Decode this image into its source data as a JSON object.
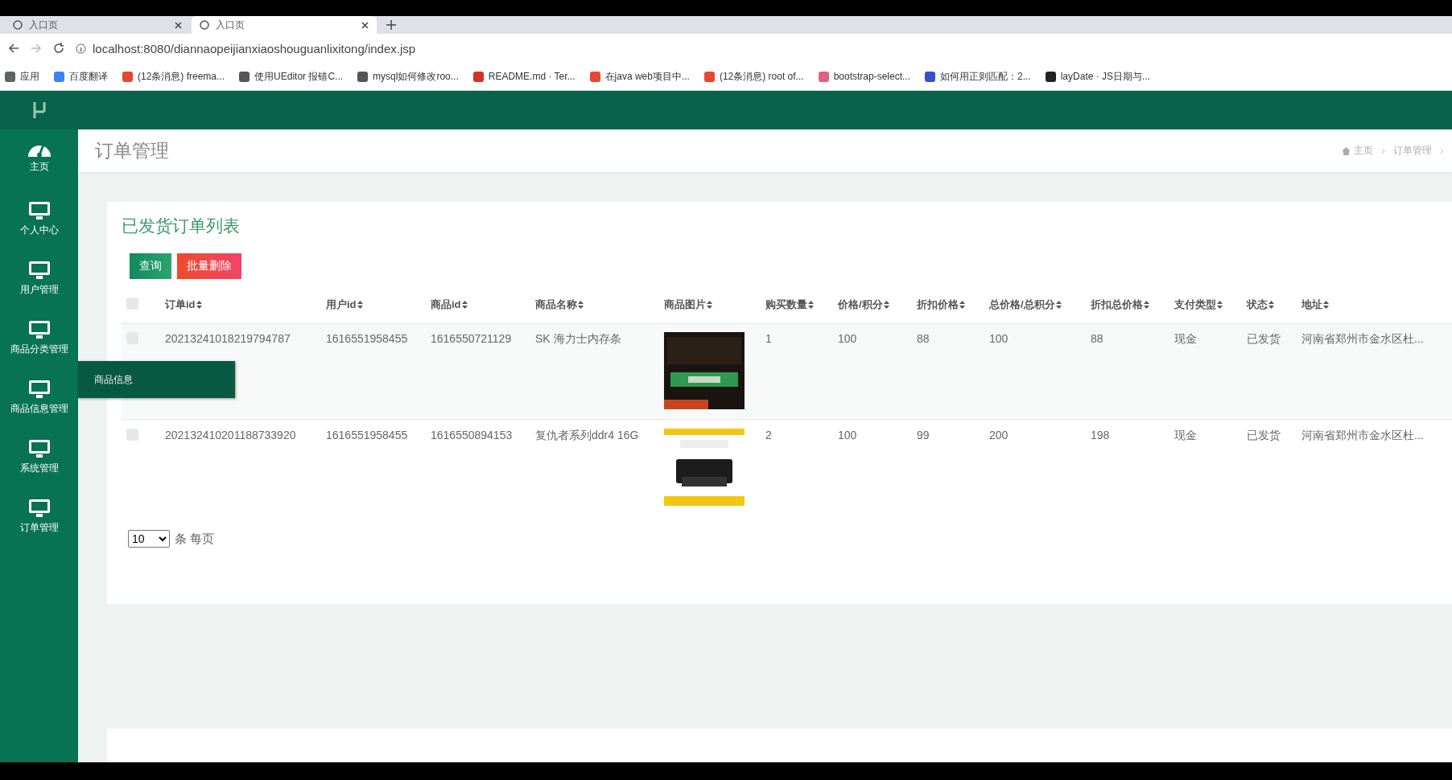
{
  "browser": {
    "tabs": [
      {
        "title": "入口页",
        "selected": false
      },
      {
        "title": "入口页",
        "selected": true
      }
    ],
    "url": "localhost:8080/diannaopeijianxiaoshouguanlixitong/index.jsp",
    "bookmarks": [
      {
        "label": "应用",
        "color": "#5f6368"
      },
      {
        "label": "百度翻译",
        "color": "#3b82f6"
      },
      {
        "label": "(12条消息) freema...",
        "color": "#e8472f"
      },
      {
        "label": "使用UEditor 报错C...",
        "color": "#555555"
      },
      {
        "label": "mysql如何修改roo...",
        "color": "#555555"
      },
      {
        "label": "README.md · Ter...",
        "color": "#d93025"
      },
      {
        "label": "在java web项目中...",
        "color": "#e8472f"
      },
      {
        "label": "(12条消息) root of...",
        "color": "#e8472f"
      },
      {
        "label": "bootstrap-select...",
        "color": "#e0607e"
      },
      {
        "label": "如何用正则匹配：2...",
        "color": "#3550c8"
      },
      {
        "label": "layDate · JS日期与...",
        "color": "#222222"
      }
    ]
  },
  "sidebar": {
    "items": [
      {
        "label": "主页",
        "kind": "dashboard"
      },
      {
        "label": "个人中心",
        "kind": "monitor"
      },
      {
        "label": "用户管理",
        "kind": "monitor"
      },
      {
        "label": "商品分类管理",
        "kind": "monitor"
      },
      {
        "label": "商品信息管理",
        "kind": "monitor",
        "submenu": [
          {
            "label": "商品信息"
          }
        ]
      },
      {
        "label": "系统管理",
        "kind": "monitor"
      },
      {
        "label": "订单管理",
        "kind": "monitor"
      }
    ]
  },
  "page_header": {
    "title": "订单管理",
    "breadcrumbs": [
      "主页",
      "订单管理"
    ]
  },
  "card": {
    "title": "已发货订单列表",
    "buttons": [
      {
        "label": "查询",
        "kind": "primary"
      },
      {
        "label": "批量删除",
        "kind": "danger"
      }
    ],
    "table": {
      "all_checked": false,
      "columns": [
        "订单id",
        "用户id",
        "商品id",
        "商品名称",
        "商品图片",
        "购买数量",
        "价格/积分",
        "折扣价格",
        "总价格/总积分",
        "折扣总价格",
        "支付类型",
        "状态",
        "地址"
      ],
      "rows": [
        {
          "checked": false,
          "cells": [
            "20213241018219794787",
            "1616551958455",
            "1616550721129",
            "SK 海力士内存条",
            {
              "kind": "picture"
            },
            "1",
            "100",
            "88",
            "100",
            "88",
            "现金",
            "已发货",
            "河南省郑州市金水区杜..."
          ]
        },
        {
          "checked": false,
          "cells": [
            "202132410201188733920",
            "1616551958455",
            "1616550894153",
            "复仇者系列ddr4 16G",
            {
              "kind": "picture"
            },
            "2",
            "100",
            "99",
            "200",
            "198",
            "现金",
            "已发货",
            "河南省郑州市金水区杜..."
          ]
        }
      ]
    },
    "page_size": "10",
    "page_size_label": "条 每页"
  }
}
